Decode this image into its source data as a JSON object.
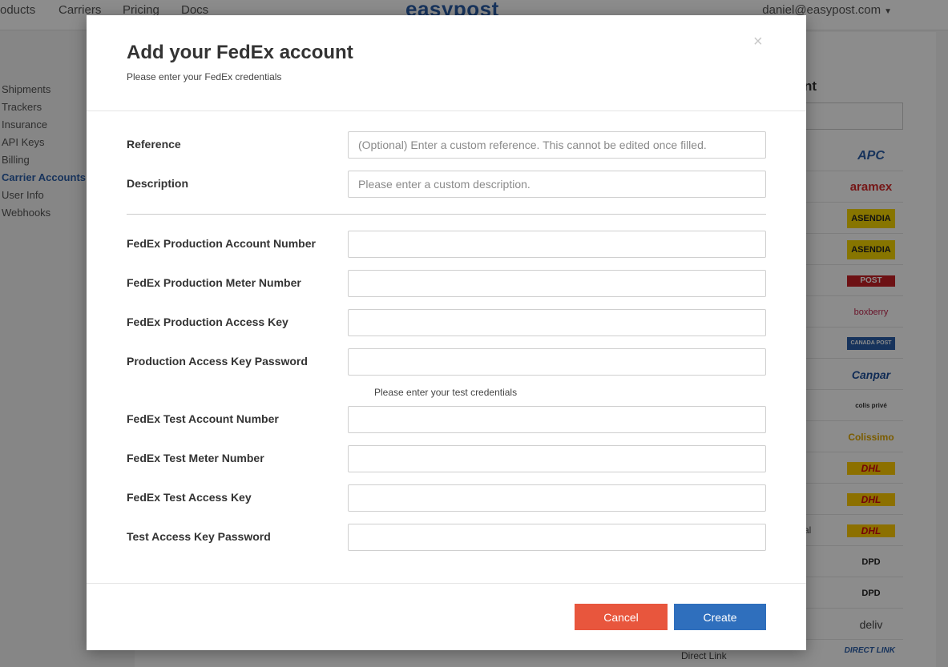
{
  "topnav": {
    "products": "oducts",
    "carriers": "Carriers",
    "pricing": "Pricing",
    "docs": "Docs",
    "logo": "easypost",
    "user": "daniel@easypost.com"
  },
  "sidenav": [
    "Shipments",
    "Trackers",
    "Insurance",
    "API Keys",
    "Billing",
    "Carrier Accounts",
    "User Info",
    "Webhooks"
  ],
  "sidenav_active": "Carrier Accounts",
  "background": {
    "heading_fragment": "nt",
    "partial_text": "al",
    "direct_link_label": "Direct Link",
    "carriers": [
      "APC",
      "aramex",
      "ASENDIA",
      "ASENDIA",
      "POST",
      "boxberry",
      "CANADA POST",
      "Canpar",
      "colis privé",
      "Colissimo",
      "DHL",
      "DHL",
      "DHL",
      "DPD",
      "DPD",
      "deliv",
      "DIRECT LINK"
    ]
  },
  "modal": {
    "title": "Add your FedEx account",
    "subtitle": "Please enter your FedEx credentials",
    "close": "×",
    "fields": {
      "reference": {
        "label": "Reference",
        "placeholder": "(Optional) Enter a custom reference. This cannot be edited once filled.",
        "value": ""
      },
      "description": {
        "label": "Description",
        "placeholder": "Please enter a custom description.",
        "value": ""
      },
      "prod_account": {
        "label": "FedEx Production Account Number",
        "value": ""
      },
      "prod_meter": {
        "label": "FedEx Production Meter Number",
        "value": ""
      },
      "prod_key": {
        "label": "FedEx Production Access Key",
        "value": ""
      },
      "prod_password": {
        "label": "Production Access Key Password",
        "value": ""
      },
      "test_account": {
        "label": "FedEx Test Account Number",
        "value": ""
      },
      "test_meter": {
        "label": "FedEx Test Meter Number",
        "value": ""
      },
      "test_key": {
        "label": "FedEx Test Access Key",
        "value": ""
      },
      "test_password": {
        "label": "Test Access Key Password",
        "value": ""
      }
    },
    "test_note": "Please enter your test credentials",
    "buttons": {
      "cancel": "Cancel",
      "create": "Create"
    }
  },
  "colors": {
    "cancel": "#e8563d",
    "create": "#2f6fbd",
    "brand": "#2a5ea8"
  }
}
